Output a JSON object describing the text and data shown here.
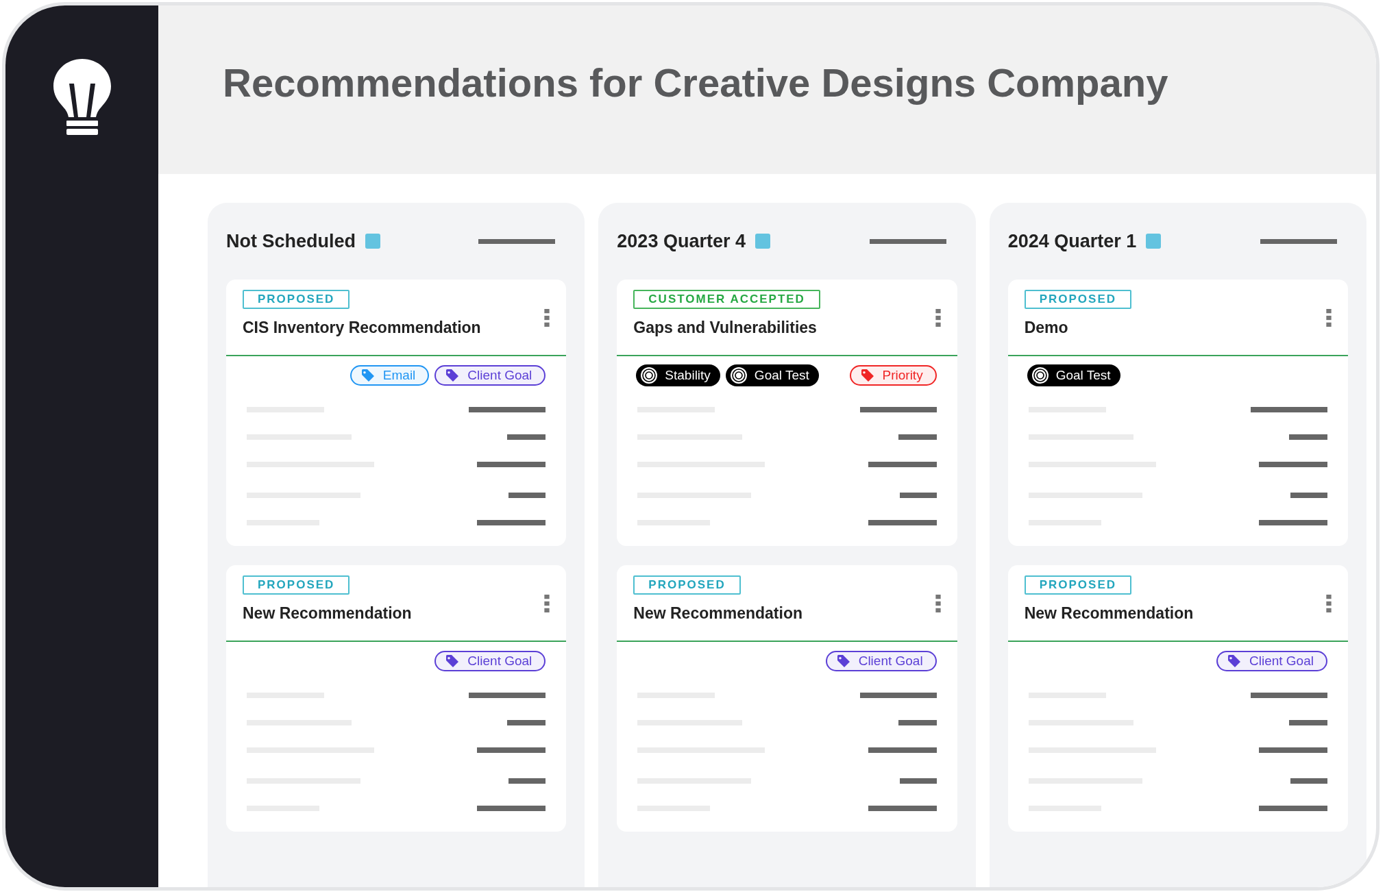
{
  "page_title": "Recommendations for Creative Designs Company",
  "columns": [
    {
      "title": "Not Scheduled",
      "color": "#63c3e0",
      "cards": [
        {
          "status": {
            "text": "PROPOSED",
            "kind": "proposed"
          },
          "title": "CIS Inventory Recommendation",
          "tags": [
            {
              "kind": "label",
              "text": "Email",
              "color": "#2196f3"
            },
            {
              "kind": "label",
              "text": "Client Goal",
              "color": "#5b3fd6"
            }
          ]
        },
        {
          "status": {
            "text": "PROPOSED",
            "kind": "proposed"
          },
          "title": "New Recommendation",
          "tags": [
            {
              "kind": "label",
              "text": "Client Goal",
              "color": "#5b3fd6"
            }
          ]
        }
      ]
    },
    {
      "title": "2023 Quarter 4",
      "color": "#63c3e0",
      "cards": [
        {
          "status": {
            "text": "CUSTOMER ACCEPTED",
            "kind": "accepted"
          },
          "title": "Gaps and Vulnerabilities",
          "tags": [
            {
              "kind": "goal",
              "text": "Stability"
            },
            {
              "kind": "goal",
              "text": "Goal Test"
            },
            {
              "kind": "label",
              "text": "Priority",
              "color": "#f02525"
            }
          ]
        },
        {
          "status": {
            "text": "PROPOSED",
            "kind": "proposed"
          },
          "title": "New Recommendation",
          "tags": [
            {
              "kind": "label",
              "text": "Client Goal",
              "color": "#5b3fd6"
            }
          ]
        }
      ]
    },
    {
      "title": "2024 Quarter 1",
      "color": "#63c3e0",
      "cards": [
        {
          "status": {
            "text": "PROPOSED",
            "kind": "proposed"
          },
          "title": "Demo",
          "tags": [
            {
              "kind": "goal",
              "text": "Goal Test"
            }
          ]
        },
        {
          "status": {
            "text": "PROPOSED",
            "kind": "proposed"
          },
          "title": "New Recommendation",
          "tags": [
            {
              "kind": "label",
              "text": "Client Goal",
              "color": "#5b3fd6"
            }
          ]
        }
      ]
    }
  ]
}
